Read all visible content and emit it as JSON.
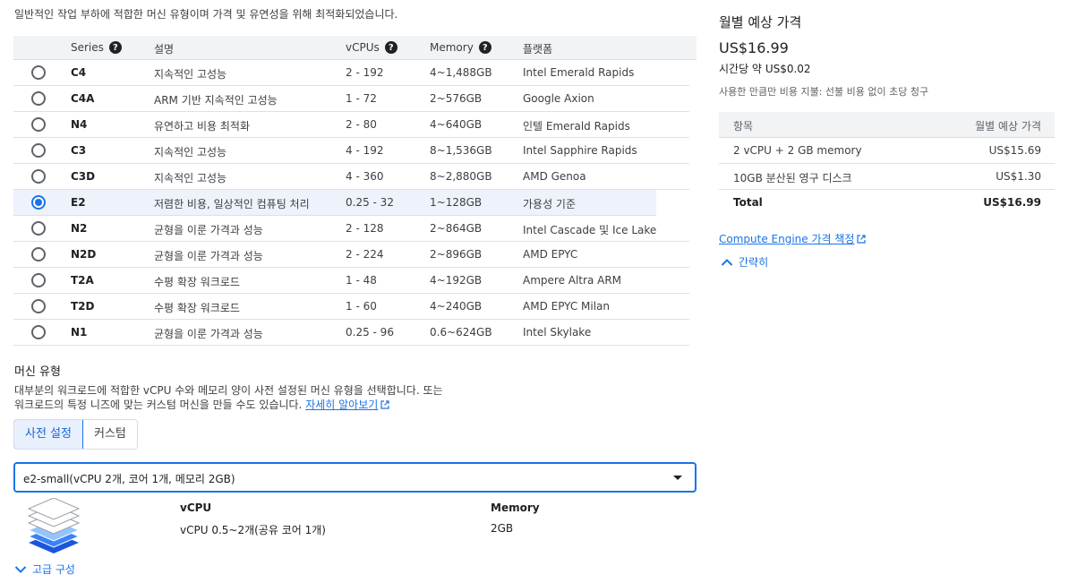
{
  "intro": "일반적인 작업 부하에 적합한 머신 유형이며 가격 및 유연성을 위해 최적화되었습니다.",
  "table": {
    "headers": {
      "series": "Series",
      "description": "설명",
      "vcpus": "vCPUs",
      "memory": "Memory",
      "platform": "플랫폼"
    },
    "rows": [
      {
        "series": "C4",
        "description": "지속적인 고성능",
        "vcpus": "2 - 192",
        "memory": "4~1,488GB",
        "platform": "Intel Emerald Rapids",
        "selected": false
      },
      {
        "series": "C4A",
        "description": "ARM 기반 지속적인 고성능",
        "vcpus": "1 - 72",
        "memory": "2~576GB",
        "platform": "Google Axion",
        "selected": false
      },
      {
        "series": "N4",
        "description": "유연하고 비용 최적화",
        "vcpus": "2 - 80",
        "memory": "4~640GB",
        "platform": "인텔 Emerald Rapids",
        "selected": false
      },
      {
        "series": "C3",
        "description": "지속적인 고성능",
        "vcpus": "4 - 192",
        "memory": "8~1,536GB",
        "platform": "Intel Sapphire Rapids",
        "selected": false
      },
      {
        "series": "C3D",
        "description": "지속적인 고성능",
        "vcpus": "4 - 360",
        "memory": "8~2,880GB",
        "platform": "AMD Genoa",
        "selected": false
      },
      {
        "series": "E2",
        "description": "저렴한 비용, 일상적인 컴퓨팅 처리",
        "vcpus": "0.25 - 32",
        "memory": "1~128GB",
        "platform": "가용성 기준",
        "selected": true
      },
      {
        "series": "N2",
        "description": "균형을 이룬 가격과 성능",
        "vcpus": "2 - 128",
        "memory": "2~864GB",
        "platform": "Intel Cascade 및 Ice Lake",
        "selected": false
      },
      {
        "series": "N2D",
        "description": "균형을 이룬 가격과 성능",
        "vcpus": "2 - 224",
        "memory": "2~896GB",
        "platform": "AMD EPYC",
        "selected": false
      },
      {
        "series": "T2A",
        "description": "수평 확장 워크로드",
        "vcpus": "1 - 48",
        "memory": "4~192GB",
        "platform": "Ampere Altra ARM",
        "selected": false
      },
      {
        "series": "T2D",
        "description": "수평 확장 워크로드",
        "vcpus": "1 - 60",
        "memory": "4~240GB",
        "platform": "AMD EPYC Milan",
        "selected": false
      },
      {
        "series": "N1",
        "description": "균형을 이룬 가격과 성능",
        "vcpus": "0.25 - 96",
        "memory": "0.6~624GB",
        "platform": "Intel Skylake",
        "selected": false
      }
    ]
  },
  "machine_type": {
    "title": "머신 유형",
    "desc_line1": "대부분의 워크로드에 적합한 vCPU 수와 메모리 양이 사전 설정된 머신 유형을 선택합니다. 또는",
    "desc_line2": "워크로드의 특정 니즈에 맞는 커스텀 머신을 만들 수도 있습니다.",
    "learn_more": "자세히 알아보기",
    "tabs": {
      "preset": "사전 설정",
      "custom": "커스텀"
    },
    "selected": "e2-small(vCPU 2개, 코어 1개, 메모리 2GB)",
    "spec": {
      "vcpu_label": "vCPU",
      "vcpu_value": "vCPU 0.5~2개(공유 코어 1개)",
      "memory_label": "Memory",
      "memory_value": "2GB"
    },
    "advanced": "고급 구성"
  },
  "pricing": {
    "title": "월별 예상 가격",
    "monthly": "US$16.99",
    "hourly_prefix": "시간당 약",
    "hourly": "US$0.02",
    "note": "사용한 만큼만 비용 지불: 선불 비용 없이 초당 청구",
    "table": {
      "head_item": "항목",
      "head_cost": "월별 예상 가격",
      "rows": [
        {
          "item": "2 vCPU + 2 GB memory",
          "cost": "US$15.69"
        },
        {
          "item": "10GB 분산된 영구 디스크",
          "cost": "US$1.30"
        }
      ],
      "total_label": "Total",
      "total_value": "US$16.99"
    },
    "link": "Compute Engine 가격 책정",
    "collapse": "간략히"
  },
  "colors": {
    "accent": "#1a73e8",
    "selected_row_bg": "#eef2fb",
    "header_bg": "#f1f3f4"
  },
  "icons": [
    "help-icon",
    "radio-icon",
    "external-link-icon",
    "dropdown-caret-icon",
    "layers-icon",
    "chevron-down-icon",
    "chevron-up-icon"
  ]
}
